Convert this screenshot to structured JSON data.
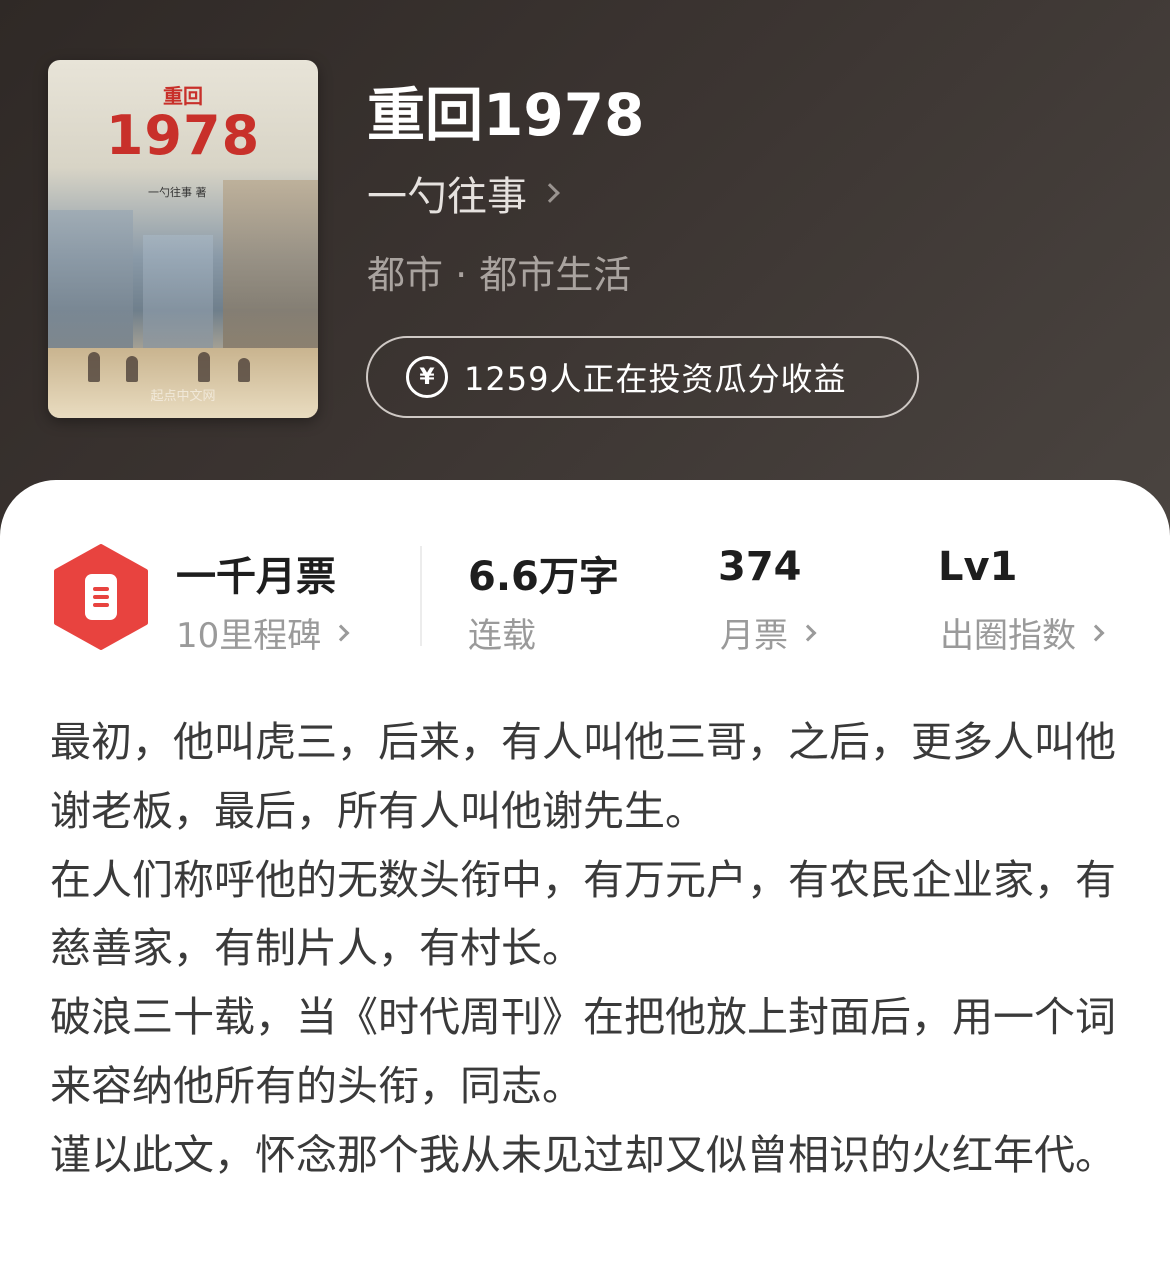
{
  "book": {
    "cover": {
      "subtitle": "重回",
      "title": "1978",
      "author": "一勺往事 著",
      "publisher": "起点中文网"
    },
    "title": "重回1978",
    "author": "一勺往事",
    "genre": "都市 · 都市生活",
    "invest_text": "1259人正在投资瓜分收益",
    "invest_icon": "yen-circle-icon"
  },
  "stats": {
    "badge": {
      "title": "一千月票",
      "sub": "10里程碑",
      "icon": "ticket-hexagon-icon",
      "color": "#e8433f"
    },
    "words": {
      "value": "6.6万字",
      "label": "连载"
    },
    "monthly": {
      "value": "374",
      "label": "月票"
    },
    "level": {
      "value": "Lv1",
      "label": "出圈指数"
    }
  },
  "synopsis": [
    "最初，他叫虎三，后来，有人叫他三哥，之后，更多人叫他谢老板，最后，所有人叫他谢先生。",
    "在人们称呼他的无数头衔中，有万元户，有农民企业家，有慈善家，有制片人，有村长。",
    "破浪三十载，当《时代周刊》在把他放上封面后，用一个词来容纳他所有的头衔，同志。",
    "谨以此文，怀念那个我从未见过却又似曾相识的火红年代。"
  ]
}
